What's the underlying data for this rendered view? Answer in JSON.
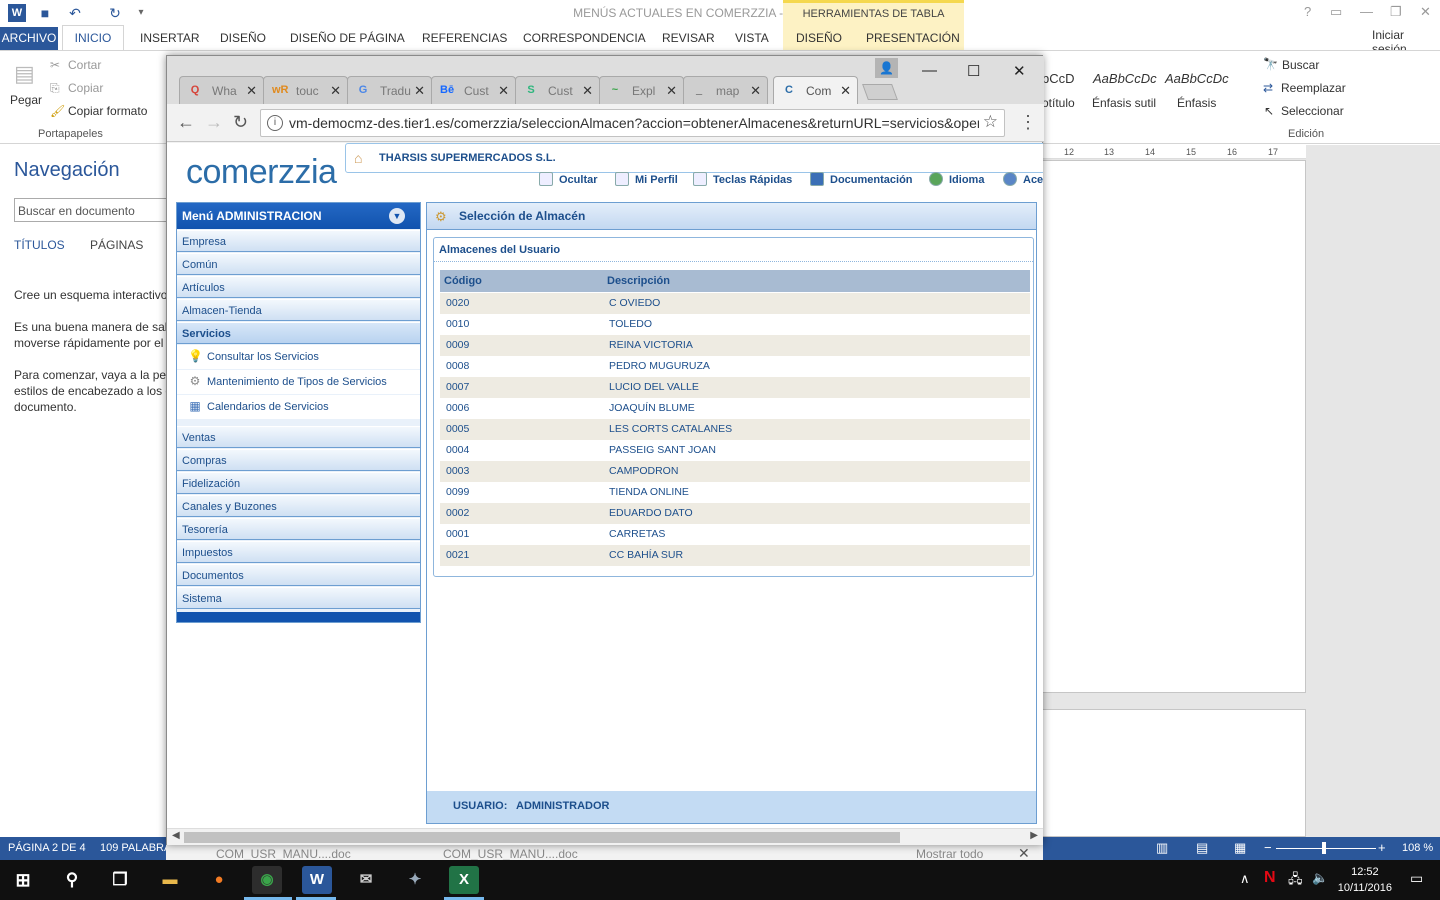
{
  "word": {
    "title": "MENÚS ACTUALES EN COMERZZIA - Microsoft Word",
    "table_tools": "HERRAMIENTAS DE TABLA",
    "tabs": [
      "ARCHIVO",
      "INICIO",
      "INSERTAR",
      "DISEÑO",
      "DISEÑO DE PÁGINA",
      "REFERENCIAS",
      "CORRESPONDENCIA",
      "REVISAR",
      "VISTA",
      "DISEÑO",
      "PRESENTACIÓN"
    ],
    "sign_in": "Iniciar sesión",
    "clipboard": {
      "paste": "Pegar",
      "cut": "Cortar",
      "copy": "Copiar",
      "format": "Copiar formato",
      "group": "Portapapeles"
    },
    "styles": [
      "bCcD",
      "AaBbCcDc",
      "AaBbCcDc"
    ],
    "style_names": [
      "otítulo",
      "Énfasis sutil",
      "Énfasis"
    ],
    "editing": {
      "find": "Buscar",
      "replace": "Reemplazar",
      "select": "Seleccionar",
      "group": "Edición"
    },
    "nav": {
      "title": "Navegación",
      "search_placeholder": "Buscar en documento",
      "tab_titles": "TÍTULOS",
      "tab_pages": "PÁGINAS",
      "p1": "Cree un esquema interactivo",
      "p2a": "Es una buena manera de sabe",
      "p2b": "moverse rápidamente por el",
      "p3a": "Para comenzar, vaya a la pest",
      "p3b": "estilos de encabezado a los e",
      "p3c": "documento."
    },
    "ruler": [
      "12",
      "13",
      "14",
      "15",
      "16",
      "17"
    ],
    "status": {
      "page": "PÁGINA 2 DE 4",
      "words": "109 PALABRA",
      "zoom": "108 %"
    }
  },
  "chrome": {
    "tabs": [
      {
        "title": "Wha",
        "fav": "Q",
        "color": "#d6443a"
      },
      {
        "title": "touc",
        "fav": "wR",
        "color": "#e08a1e"
      },
      {
        "title": "Tradu",
        "fav": "G",
        "color": "#4a86e8"
      },
      {
        "title": "Cust",
        "fav": "Bē",
        "color": "#1769ff"
      },
      {
        "title": "Cust",
        "fav": "S",
        "color": "#2eb67d"
      },
      {
        "title": "Expl",
        "fav": "~",
        "color": "#3aa54a"
      },
      {
        "title": "map",
        "fav": "_",
        "color": "#222222"
      },
      {
        "title": "Com",
        "fav": "C",
        "color": "#2c6da8"
      }
    ],
    "url": "vm-democmz-des.tier1.es/comerzzia/seleccionAlmacen?accion=obtenerAlmacenes&returnURL=servicios&oper"
  },
  "app": {
    "logo": "comerzzia",
    "company": "THARSIS SUPERMERCADOS S.L.",
    "links": [
      "Ocultar",
      "Mi Perfil",
      "Teclas Rápidas",
      "Documentación",
      "Idioma",
      "Ace"
    ],
    "menu_title": "Menú ADMINISTRACION",
    "menu_items": [
      "Empresa",
      "Común",
      "Artículos",
      "Almacen-Tienda",
      "Servicios",
      "Ventas",
      "Compras",
      "Fidelización",
      "Canales y Buzones",
      "Tesorería",
      "Impuestos",
      "Documentos",
      "Sistema"
    ],
    "submenu": [
      "Consultar los Servicios",
      "Mantenimiento de Tipos de Servicios",
      "Calendarios de Servicios"
    ],
    "panel_title": "Selección de Almacén",
    "box_title": "Almacenes del Usuario",
    "col_code": "Código",
    "col_desc": "Descripción",
    "rows": [
      [
        "0020",
        "C OVIEDO"
      ],
      [
        "0010",
        "TOLEDO"
      ],
      [
        "0009",
        "REINA VICTORIA"
      ],
      [
        "0008",
        "PEDRO MUGURUZA"
      ],
      [
        "0007",
        "LUCIO DEL VALLE"
      ],
      [
        "0006",
        "JOAQUÍN BLUME"
      ],
      [
        "0005",
        "LES CORTS CATALANES"
      ],
      [
        "0004",
        "PASSEIG SANT JOAN"
      ],
      [
        "0003",
        "CAMPODRON"
      ],
      [
        "0099",
        "TIENDA ONLINE"
      ],
      [
        "0002",
        "EDUARDO DATO"
      ],
      [
        "0001",
        "CARRETAS"
      ],
      [
        "0021",
        "CC BAHÍA SUR"
      ]
    ],
    "user_label": "USUARIO:",
    "user_name": "ADMINISTRADOR"
  },
  "downloads": {
    "file1": "COM_USR_MANU....doc",
    "file2": "COM_USR_MANU....doc",
    "show_all": "Mostrar todo"
  },
  "taskbar": {
    "time": "12:52",
    "date": "10/11/2016"
  }
}
